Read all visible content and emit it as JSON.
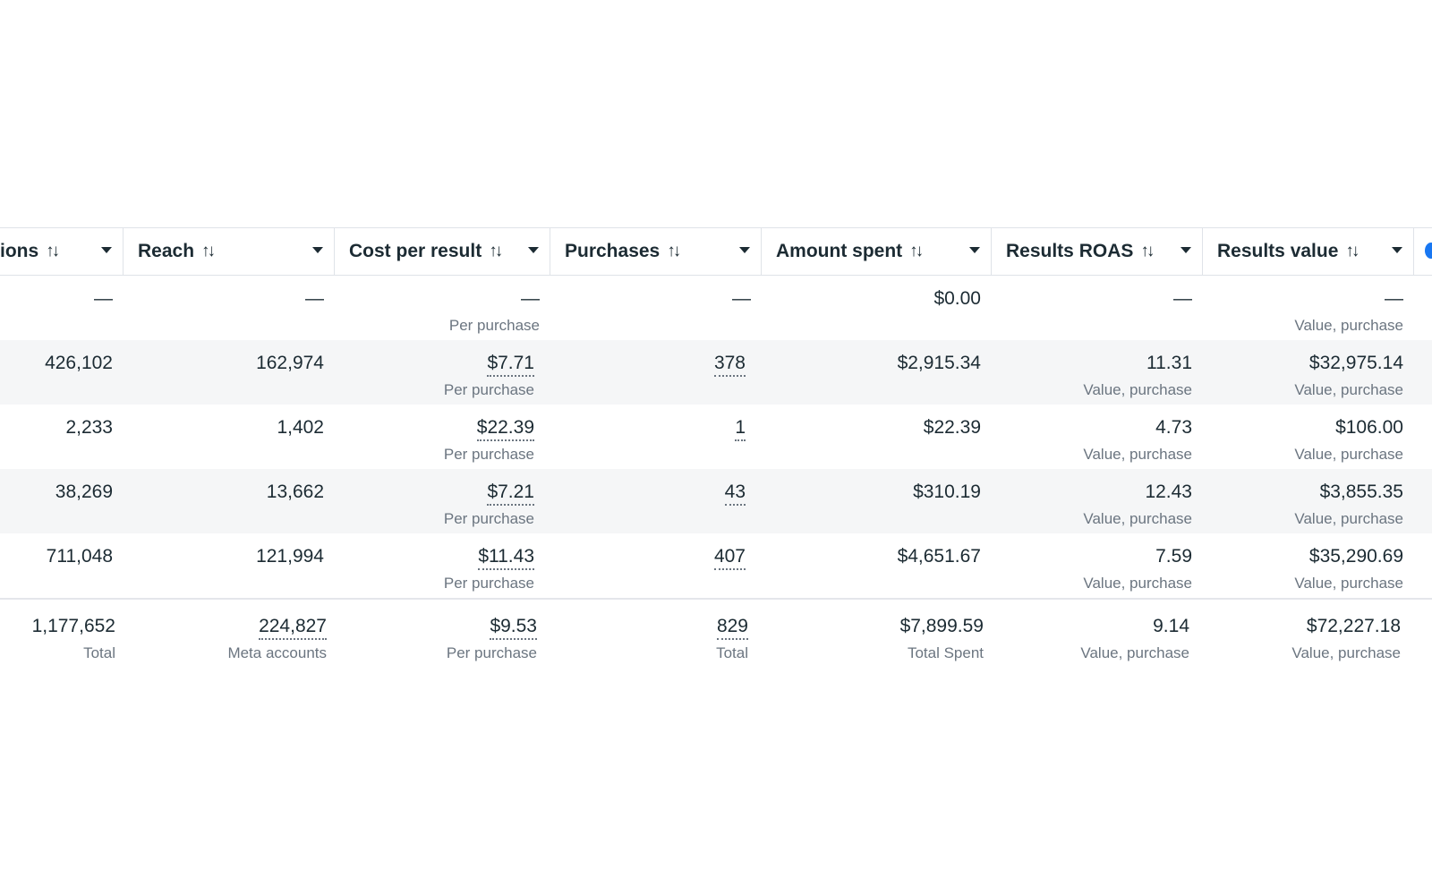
{
  "columns": [
    {
      "label": "ions",
      "sort": "↑↓"
    },
    {
      "label": "Reach",
      "sort": "↑↓"
    },
    {
      "label": "Cost per result",
      "sort": "↑↓"
    },
    {
      "label": "Purchases",
      "sort": "↑↓"
    },
    {
      "label": "Amount spent",
      "sort": "↑↓"
    },
    {
      "label": "Results ROAS",
      "sort": "↑↓"
    },
    {
      "label": "Results value",
      "sort": "↑↓"
    }
  ],
  "rows": [
    {
      "cells": [
        {
          "value": "—",
          "sub": ""
        },
        {
          "value": "—",
          "sub": ""
        },
        {
          "value": "—",
          "sub": "Per purchase"
        },
        {
          "value": "—",
          "sub": ""
        },
        {
          "value": "$0.00",
          "sub": ""
        },
        {
          "value": "—",
          "sub": ""
        },
        {
          "value": "—",
          "sub": "Value, purchase"
        }
      ]
    },
    {
      "cells": [
        {
          "value": "426,102",
          "sub": ""
        },
        {
          "value": "162,974",
          "sub": ""
        },
        {
          "value": "$7.71",
          "sub": "Per purchase"
        },
        {
          "value": "378",
          "sub": ""
        },
        {
          "value": "$2,915.34",
          "sub": ""
        },
        {
          "value": "11.31",
          "sub": "Value, purchase"
        },
        {
          "value": "$32,975.14",
          "sub": "Value, purchase"
        }
      ]
    },
    {
      "cells": [
        {
          "value": "2,233",
          "sub": ""
        },
        {
          "value": "1,402",
          "sub": ""
        },
        {
          "value": "$22.39",
          "sub": "Per purchase"
        },
        {
          "value": "1",
          "sub": ""
        },
        {
          "value": "$22.39",
          "sub": ""
        },
        {
          "value": "4.73",
          "sub": "Value, purchase"
        },
        {
          "value": "$106.00",
          "sub": "Value, purchase"
        }
      ]
    },
    {
      "cells": [
        {
          "value": "38,269",
          "sub": ""
        },
        {
          "value": "13,662",
          "sub": ""
        },
        {
          "value": "$7.21",
          "sub": "Per purchase"
        },
        {
          "value": "43",
          "sub": ""
        },
        {
          "value": "$310.19",
          "sub": ""
        },
        {
          "value": "12.43",
          "sub": "Value, purchase"
        },
        {
          "value": "$3,855.35",
          "sub": "Value, purchase"
        }
      ]
    },
    {
      "cells": [
        {
          "value": "711,048",
          "sub": ""
        },
        {
          "value": "121,994",
          "sub": ""
        },
        {
          "value": "$11.43",
          "sub": "Per purchase"
        },
        {
          "value": "407",
          "sub": ""
        },
        {
          "value": "$4,651.67",
          "sub": ""
        },
        {
          "value": "7.59",
          "sub": "Value, purchase"
        },
        {
          "value": "$35,290.69",
          "sub": "Value, purchase"
        }
      ]
    }
  ],
  "totals": {
    "cells": [
      {
        "value": "1,177,652",
        "sub": "Total"
      },
      {
        "value": "224,827",
        "sub": "Meta accounts"
      },
      {
        "value": "$9.53",
        "sub": "Per purchase"
      },
      {
        "value": "829",
        "sub": "Total"
      },
      {
        "value": "$7,899.59",
        "sub": "Total Spent"
      },
      {
        "value": "9.14",
        "sub": "Value, purchase"
      },
      {
        "value": "$72,227.18",
        "sub": "Value, purchase"
      }
    ]
  }
}
